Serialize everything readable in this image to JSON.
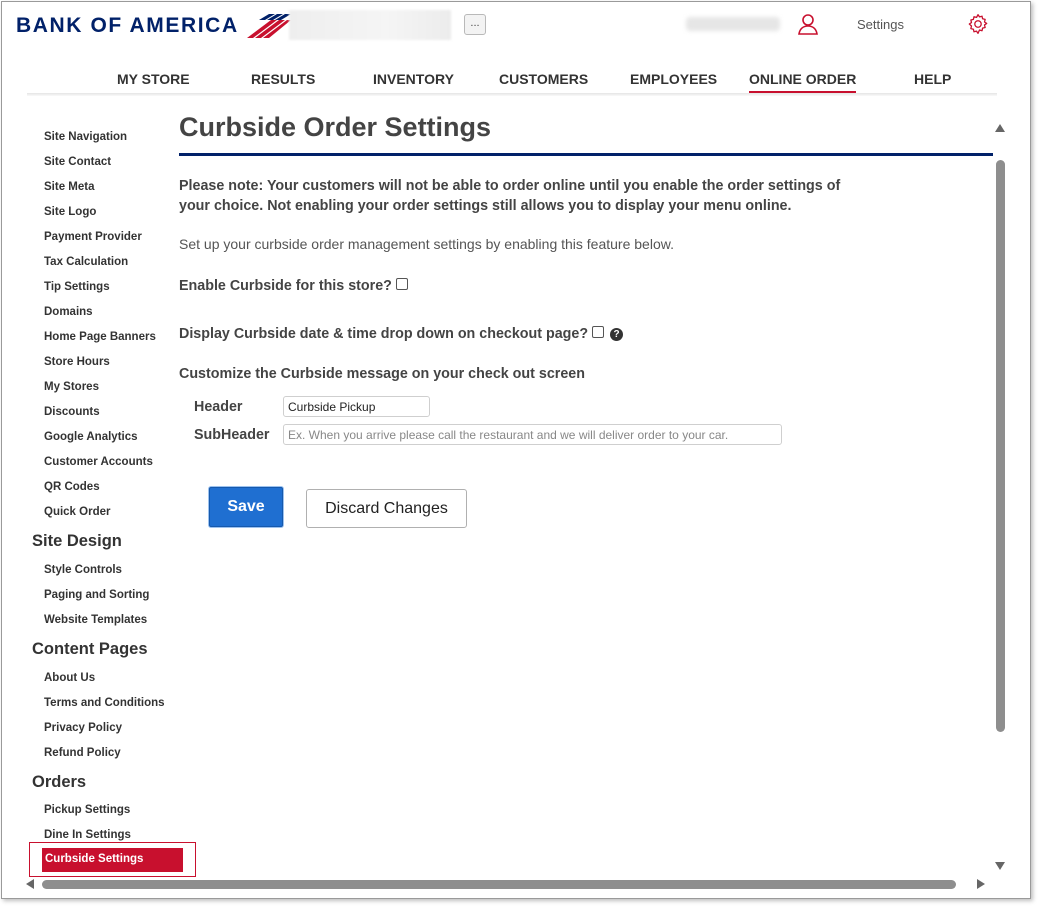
{
  "brand": {
    "name": "BANK OF AMERICA",
    "red": "#c8102e",
    "navy": "#012169"
  },
  "header": {
    "more_label": "...",
    "settings_label": "Settings",
    "icons": [
      "user-icon",
      "gear-icon"
    ]
  },
  "nav": {
    "items": [
      {
        "label": "MY STORE",
        "active": false
      },
      {
        "label": "RESULTS",
        "active": false
      },
      {
        "label": "INVENTORY",
        "active": false
      },
      {
        "label": "CUSTOMERS",
        "active": false
      },
      {
        "label": "EMPLOYEES",
        "active": false
      },
      {
        "label": "ONLINE ORDER",
        "active": true
      },
      {
        "label": "HELP",
        "active": false
      }
    ]
  },
  "sidebar": {
    "links_top": [
      "Site Navigation",
      "Site Contact",
      "Site Meta",
      "Site Logo",
      "Payment Provider",
      "Tax Calculation",
      "Tip Settings",
      "Domains",
      "Home Page Banners",
      "Store Hours",
      "My Stores",
      "Discounts",
      "Google Analytics",
      "Customer Accounts",
      "QR Codes",
      "Quick Order"
    ],
    "site_design": {
      "heading": "Site Design",
      "links": [
        "Style Controls",
        "Paging and Sorting",
        "Website Templates"
      ]
    },
    "content_pages": {
      "heading": "Content Pages",
      "links": [
        "About Us",
        "Terms and Conditions",
        "Privacy Policy",
        "Refund Policy"
      ]
    },
    "orders": {
      "heading": "Orders",
      "links": [
        "Pickup Settings",
        "Dine In Settings"
      ],
      "active": "Curbside Settings"
    }
  },
  "main": {
    "title": "Curbside Order Settings",
    "note": "Please note: Your customers will not be able to order online until you enable the order settings of your choice. Not enabling your order settings still allows you to display your menu online.",
    "setup_text": "Set up your curbside order management settings by enabling this feature below.",
    "enable_label": "Enable Curbside for this store?",
    "enable_checked": false,
    "dropdown_label": "Display Curbside date & time drop down on checkout page?",
    "dropdown_checked": false,
    "help_glyph": "?",
    "customize_label": "Customize the Curbside message on your check out screen",
    "header_label": "Header",
    "header_value": "Curbside Pickup",
    "subheader_label": "SubHeader",
    "subheader_value": "",
    "subheader_placeholder": "Ex. When you arrive please call the restaurant and we will deliver order to your car.",
    "save_label": "Save",
    "discard_label": "Discard Changes"
  }
}
